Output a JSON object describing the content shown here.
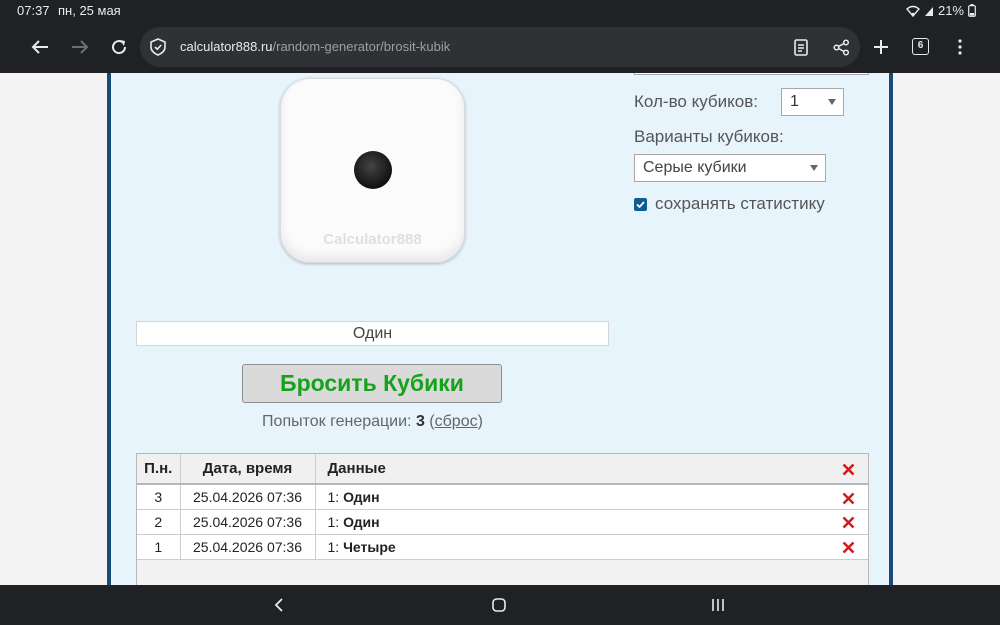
{
  "status_bar": {
    "time": "07:37",
    "date": "пн, 25 мая",
    "battery": "21%",
    "icons": [
      "wifi-icon",
      "signal-icon",
      "battery-icon"
    ]
  },
  "browser": {
    "url_host": "calculator888.ru",
    "url_path": "/random-generator/brosit-kubik",
    "tab_count": "6",
    "icons": [
      "back-arrow-icon",
      "forward-arrow-icon",
      "reload-icon",
      "site-info-icon",
      "reader-mode-icon",
      "share-icon",
      "new-tab-plus-icon",
      "tabs-icon",
      "more-vert-icon"
    ]
  },
  "dice": {
    "watermark": "Calculator888",
    "face_value": 1
  },
  "settings": {
    "count_label": "Кол-во кубиков:",
    "count_value": "1",
    "variants_label": "Варианты кубиков:",
    "variants_value": "Серые кубики",
    "save_stats_label": "сохранять статистику",
    "save_stats_checked": true
  },
  "result": {
    "text": "Один"
  },
  "roll_button": {
    "label": "Бросить Кубики"
  },
  "attempts": {
    "prefix": "Попыток генерации: ",
    "count": "3",
    "reset_label": "сброс"
  },
  "history": {
    "headers": [
      "П.н.",
      "Дата, время",
      "Данные"
    ],
    "rows": [
      {
        "n": "3",
        "datetime": "25.04.2026 07:36",
        "data_prefix": "1: ",
        "data_value": "Один"
      },
      {
        "n": "2",
        "datetime": "25.04.2026 07:36",
        "data_prefix": "1: ",
        "data_value": "Один"
      },
      {
        "n": "1",
        "datetime": "25.04.2026 07:36",
        "data_prefix": "1: ",
        "data_value": "Четыре"
      }
    ]
  },
  "colors": {
    "accent_green": "#17a21c",
    "panel_bg": "#e8f4fc",
    "panel_border": "#1a4a7a",
    "delete_red": "#cc1f1f"
  }
}
